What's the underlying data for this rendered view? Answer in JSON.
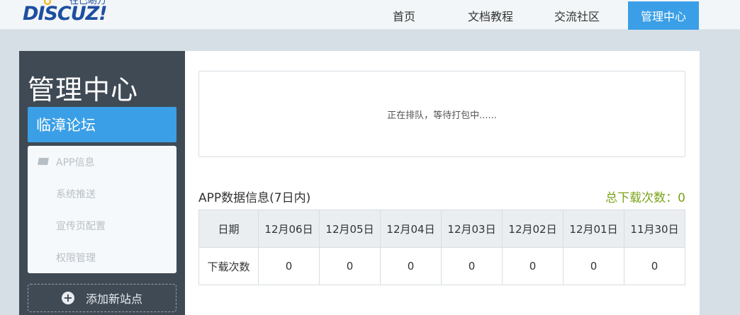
{
  "header": {
    "logo_text": "DISCUZ!",
    "logo_sub": "往已啲万",
    "nav": [
      {
        "label": "首页"
      },
      {
        "label": "文档教程"
      },
      {
        "label": "交流社区"
      },
      {
        "label": "管理中心",
        "active": true
      }
    ]
  },
  "sidebar": {
    "title": "管理中心",
    "site_name": "临漳论坛",
    "menu": [
      {
        "label": "APP信息",
        "icon": "app-info-icon"
      },
      {
        "label": "系统推送"
      },
      {
        "label": "宣传页配置"
      },
      {
        "label": "权限管理"
      }
    ],
    "add_site_label": "添加新站点"
  },
  "main": {
    "queue_status": "正在排队，等待打包中......",
    "stats_title": "APP数据信息(7日内)",
    "stats_total": "总下载次数：0",
    "table": {
      "header_label": "日期",
      "row_label": "下载次数",
      "dates": [
        "12月06日",
        "12月05日",
        "12月04日",
        "12月03日",
        "12月02日",
        "12月01日",
        "11月30日"
      ],
      "counts": [
        "0",
        "0",
        "0",
        "0",
        "0",
        "0",
        "0"
      ]
    }
  },
  "colors": {
    "accent": "#3a9fe6",
    "sidebar_bg": "#3f4a55",
    "total_green": "#7aa31a",
    "brand_blue": "#1d4fa0"
  }
}
